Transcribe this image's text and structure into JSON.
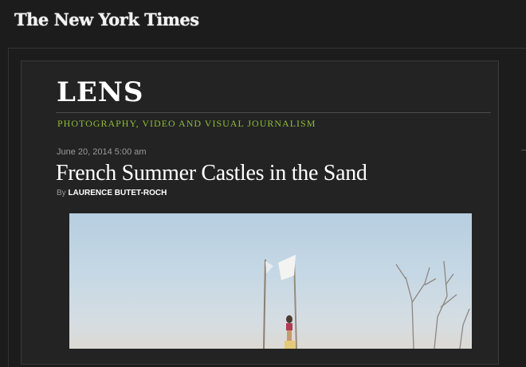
{
  "masthead": {
    "logo_text": "The New York Times"
  },
  "blog": {
    "title": "LENS",
    "tagline": "PHOTOGRAPHY, VIDEO AND VISUAL JOURNALISM"
  },
  "article": {
    "date": "June 20, 2014 5:00 am",
    "headline": "French Summer Castles in the Sand",
    "byline_prefix": "By",
    "author": "LAURENCE BUTET-ROCH"
  },
  "colors": {
    "background": "#1c1c1c",
    "panel": "#232323",
    "tagline_accent": "#8dbb3a",
    "text": "#ffffff"
  }
}
